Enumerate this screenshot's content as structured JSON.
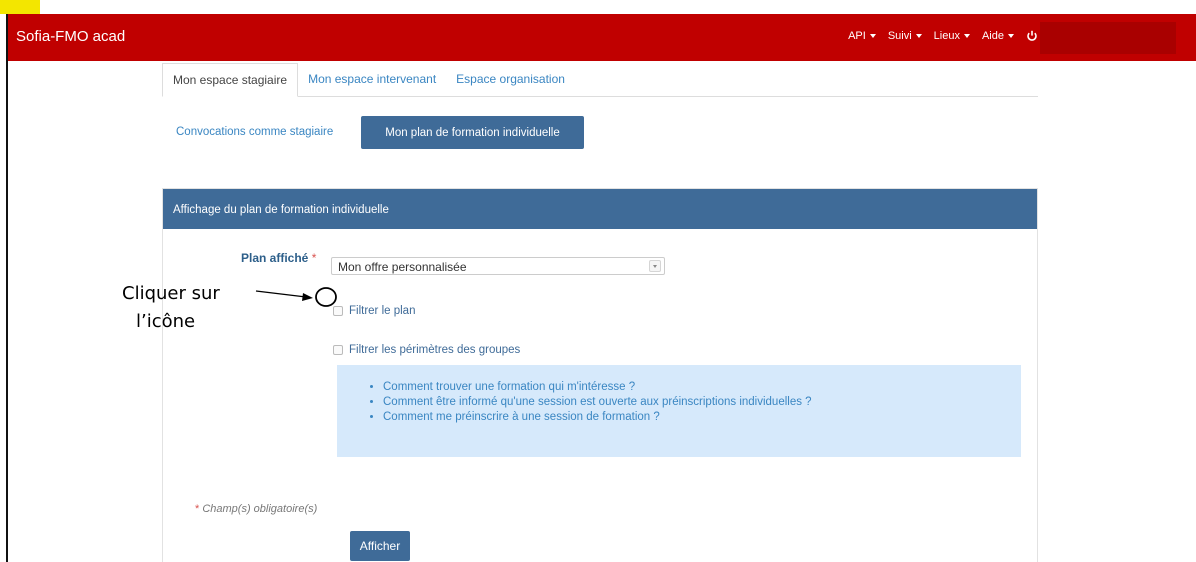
{
  "app": {
    "brand": "Sofia-FMO acad",
    "nav": [
      {
        "label": "API"
      },
      {
        "label": "Suivi"
      },
      {
        "label": "Lieux"
      },
      {
        "label": "Aide"
      }
    ],
    "power_icon": "power-icon"
  },
  "tabs": [
    {
      "label": "Mon espace stagiaire",
      "active": true
    },
    {
      "label": "Mon espace intervenant",
      "active": false
    },
    {
      "label": "Espace organisation",
      "active": false
    }
  ],
  "subnav": {
    "link": "Convocations comme stagiaire",
    "active": "Mon plan de formation individuelle"
  },
  "panel": {
    "title": "Affichage du plan de formation individuelle",
    "plan_label": "Plan affiché",
    "required_mark": "*",
    "plan_value": "Mon offre personnalisée",
    "filter_plan": "Filtrer le plan",
    "filter_groups": "Filtrer les périmètres des groupes",
    "help_links": [
      "Comment trouver une formation qui m'intéresse ?",
      "Comment être informé qu'une session est ouverte aux préinscriptions individuelles ?",
      "Comment me préinscrire à une session de formation ?"
    ],
    "required_note": "Champ(s) obligatoire(s)",
    "submit": "Afficher"
  },
  "annotation": {
    "line1": "Cliquer sur",
    "line2": "l’icône"
  },
  "colors": {
    "navbar": "#c00000",
    "primary": "#3f6b98",
    "link": "#3a86c2",
    "info_bg": "#d6e9fb",
    "marker": "#f3e600"
  }
}
